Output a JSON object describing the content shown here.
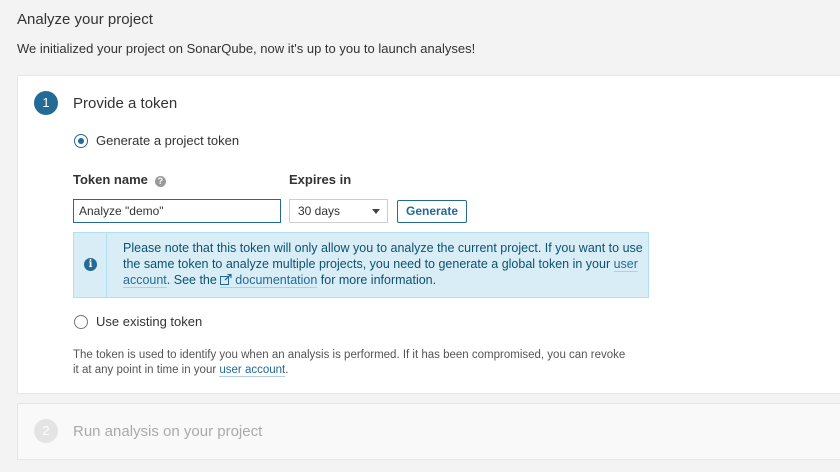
{
  "page": {
    "title": "Analyze your project",
    "description": "We initialized your project on SonarQube, now it's up to you to launch analyses!"
  },
  "step1": {
    "number": "1",
    "title": "Provide a token",
    "generate_option": "Generate a project token",
    "token_name_label": "Token name",
    "help_glyph": "?",
    "expires_label": "Expires in",
    "token_name_value": "Analyze \"demo\"",
    "expires_value": "30 days",
    "expires_options": [
      "30 days"
    ],
    "generate_button": "Generate",
    "info": {
      "icon": "info-icon",
      "glyph": "i",
      "text_before": "Please note that this token will only allow you to analyze the current project. If you want to use the same token to analyze multiple projects, you need to generate a global token in your ",
      "user_account_link": "user account",
      "text_middle": ". See the ",
      "documentation_link": "documentation",
      "text_after": " for more information."
    },
    "existing_option": "Use existing token",
    "footnote_before": "The token is used to identify you when an analysis is performed. If it has been compromised, you can revoke it at any point in time in your ",
    "footnote_link": "user account",
    "footnote_after": "."
  },
  "step2": {
    "number": "2",
    "title": "Run analysis on your project"
  },
  "colors": {
    "accent": "#236a97",
    "info_bg": "#d9edf7",
    "info_text": "#0e516f",
    "page_bg": "#f3f3f3"
  }
}
